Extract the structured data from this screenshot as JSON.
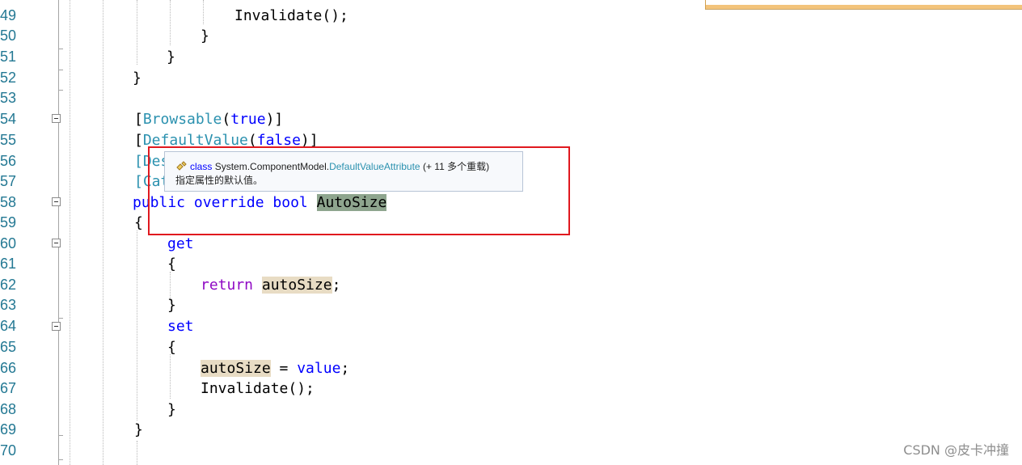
{
  "line_numbers": [
    "49",
    "50",
    "51",
    "52",
    "53",
    "54",
    "55",
    "56",
    "57",
    "58",
    "59",
    "60",
    "61",
    "62",
    "63",
    "64",
    "65",
    "66",
    "67",
    "68",
    "69",
    "70"
  ],
  "code": {
    "l49": "Invalidate();",
    "l50": "}",
    "l51": "}",
    "l52": "}",
    "l54_open": "[",
    "l54_type": "Browsable",
    "l54_arg": "(",
    "l54_val": "true",
    "l54_close": ")]",
    "l55_open": "[",
    "l55_type": "DefaultValue",
    "l55_arg": "(",
    "l55_val": "false",
    "l55_close": ")]",
    "l56": "[Des",
    "l57": "[Cat",
    "l58_public": "public",
    "l58_override": "override",
    "l58_bool": "bool",
    "l58_name": "AutoSize",
    "l59": "{",
    "l60": "get",
    "l61": "{",
    "l62_return": "return",
    "l62_var": "autoSize",
    "l62_end": ";",
    "l63": "}",
    "l64": "set",
    "l65": "{",
    "l66_var": "autoSize",
    "l66_eq": " = ",
    "l66_value": "value",
    "l66_end": ";",
    "l67": "Invalidate();",
    "l68": "}",
    "l69": "}"
  },
  "tooltip": {
    "kind": "class",
    "namespace": "System.ComponentModel.",
    "type_name": "DefaultValueAttribute",
    "overloads": "(+ 11 多个重载)",
    "description": "指定属性的默认值。"
  },
  "watermark": "CSDN @皮卡冲撞",
  "colors": {
    "keyword": "#0000ff",
    "control_keyword": "#8f08c4",
    "type": "#2b91af",
    "highlight_reference": "#e8dcc4",
    "highlight_selected": "#8ea58e",
    "annotation_box": "#e0191f"
  }
}
